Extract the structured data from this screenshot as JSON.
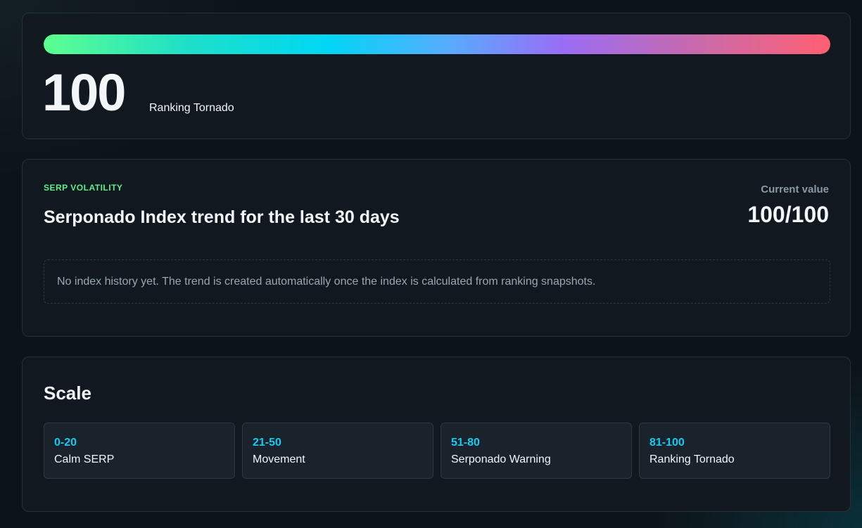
{
  "score_card": {
    "score": "100",
    "level_label": "Ranking Tornado",
    "gauge_fraction": 1.0
  },
  "trend_card": {
    "eyebrow": "SERP VOLATILITY",
    "title": "Serponado Index trend for the last 30 days",
    "current_label": "Current value",
    "current_value": "100/100",
    "empty_message": "No index history yet. The trend is created automatically once the index is calculated from ranking snapshots."
  },
  "scale_card": {
    "title": "Scale",
    "items": [
      {
        "range": "0-20",
        "name": "Calm SERP"
      },
      {
        "range": "21-50",
        "name": "Movement"
      },
      {
        "range": "51-80",
        "name": "Serponado Warning"
      },
      {
        "range": "81-100",
        "name": "Ranking Tornado"
      }
    ]
  },
  "colors": {
    "accent_green": "#5cf08a",
    "accent_cyan": "#10cdf0",
    "accent_red": "#ff5f73",
    "background": "#0d1419",
    "card": "#111820"
  }
}
